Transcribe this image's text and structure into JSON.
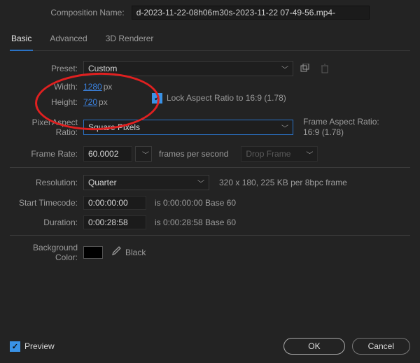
{
  "header": {
    "comp_name_label": "Composition Name:",
    "comp_name_value": "d-2023-11-22-08h06m30s-2023-11-22 07-49-56.mp4-"
  },
  "tabs": {
    "basic": "Basic",
    "advanced": "Advanced",
    "renderer": "3D Renderer"
  },
  "preset": {
    "label": "Preset:",
    "value": "Custom"
  },
  "dims": {
    "width_label": "Width:",
    "width_value": "1280",
    "px": "px",
    "height_label": "Height:",
    "height_value": "720",
    "lock_label": "Lock Aspect Ratio to 16:9 (1.78)"
  },
  "par": {
    "label": "Pixel Aspect Ratio:",
    "value": "Square Pixels",
    "ratio_label": "Frame Aspect Ratio:",
    "ratio_value": "16:9 (1.78)"
  },
  "framerate": {
    "label": "Frame Rate:",
    "value": "60.0002",
    "fps_label": "frames per second",
    "drop": "Drop Frame"
  },
  "resolution": {
    "label": "Resolution:",
    "value": "Quarter",
    "info": "320 x 180, 225 KB per 8bpc frame"
  },
  "start_tc": {
    "label": "Start Timecode:",
    "value": "0:00:00:00",
    "info": "is 0:00:00:00  Base 60"
  },
  "duration": {
    "label": "Duration:",
    "value": "0:00:28:58",
    "info": "is 0:00:28:58  Base 60"
  },
  "bg": {
    "label": "Background Color:",
    "name": "Black"
  },
  "footer": {
    "preview": "Preview",
    "ok": "OK",
    "cancel": "Cancel"
  }
}
